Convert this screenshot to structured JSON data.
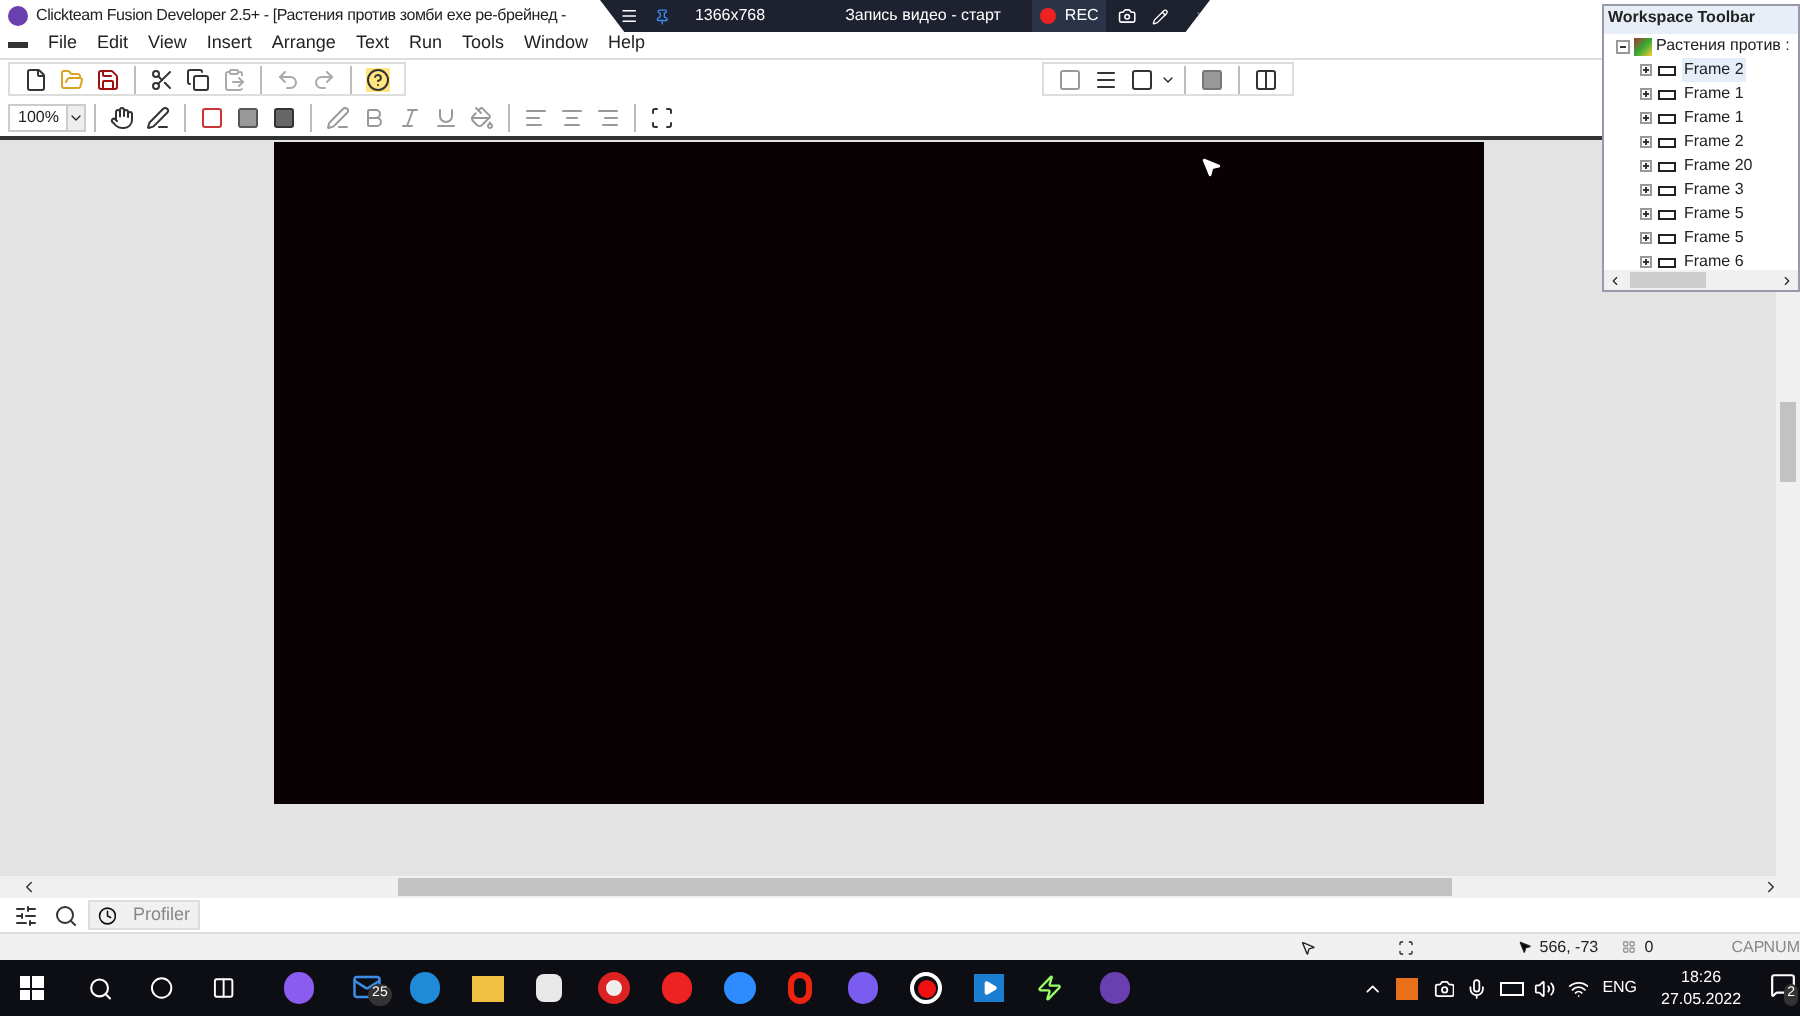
{
  "window": {
    "title": "Clickteam Fusion Developer 2.5+ - [Растения против зомби exe ре-брейнед -"
  },
  "menu": [
    "File",
    "Edit",
    "View",
    "Insert",
    "Arrange",
    "Text",
    "Run",
    "Tools",
    "Window",
    "Help"
  ],
  "zoom": {
    "value": "100%"
  },
  "recorder": {
    "resolution": "1366x768",
    "title": "Запись видео - старт",
    "rec": "REC"
  },
  "workspace": {
    "title": "Workspace Toolbar",
    "root": {
      "label": "Растения против : ",
      "expanded": true,
      "children": [
        {
          "label": "Frame 2",
          "selected": true
        },
        {
          "label": "Frame 1",
          "selected": false
        },
        {
          "label": "Frame 1",
          "selected": false
        },
        {
          "label": "Frame 2",
          "selected": false
        },
        {
          "label": "Frame 20",
          "selected": false
        },
        {
          "label": "Frame 3",
          "selected": false
        },
        {
          "label": "Frame 5",
          "selected": false
        },
        {
          "label": "Frame 5",
          "selected": false
        },
        {
          "label": "Frame 6",
          "selected": false
        }
      ]
    }
  },
  "bottom_tabs": [
    {
      "label": "Profiler",
      "selected": true
    }
  ],
  "status_bar": {
    "coords": "566, -73",
    "count": "0",
    "caps": "CAP",
    "num": "NUM"
  },
  "taskbar": {
    "mail_badge": "25",
    "language": "ENG",
    "time": "18:26",
    "date": "27.05.2022",
    "notifications": "2"
  }
}
